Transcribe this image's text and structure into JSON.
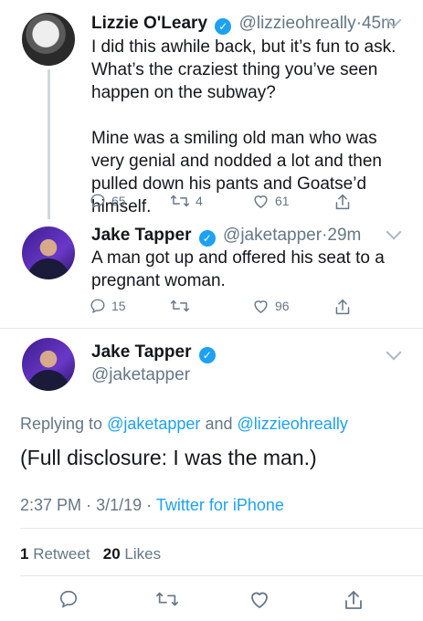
{
  "tweets": [
    {
      "name": "Lizzie O'Leary",
      "handle": "@lizzieohreally",
      "sep": "·",
      "time": "45m",
      "text": "I did this awhile back, but it’s fun to ask. What’s the craziest thing you’ve seen happen on the subway?\n\nMine was a smiling old man who was very genial and nodded a lot and then pulled down his pants and Goatse’d himself.",
      "replies": "65",
      "retweets": "4",
      "likes": "61"
    },
    {
      "name": "Jake Tapper",
      "handle": "@jaketapper",
      "sep": "·",
      "time": "29m",
      "text": "A man got up and offered his seat to a pregnant woman.",
      "replies": "15",
      "retweets": "",
      "likes": "96"
    }
  ],
  "focus": {
    "name": "Jake Tapper",
    "handle": "@jaketapper",
    "replying_prefix": "Replying to",
    "replying_user1": "@jaketapper",
    "replying_and": "and",
    "replying_user2": "@lizzieohreally",
    "text": "(Full disclosure: I was the man.)",
    "time": "2:37 PM",
    "date_sep": "·",
    "date": "3/1/19",
    "source_sep": "·",
    "source": "Twitter for iPhone",
    "retweet_count": "1",
    "retweet_label": "Retweet",
    "like_count": "20",
    "like_label": "Likes"
  },
  "icons": {
    "reply": "reply-icon",
    "retweet": "retweet-icon",
    "like": "heart-icon",
    "share": "share-icon",
    "verified": "verified-badge-icon",
    "more": "chevron-down-icon"
  },
  "colors": {
    "accent": "#1da1f2",
    "muted": "#657786",
    "text": "#14171a",
    "line": "#cfd9de"
  }
}
